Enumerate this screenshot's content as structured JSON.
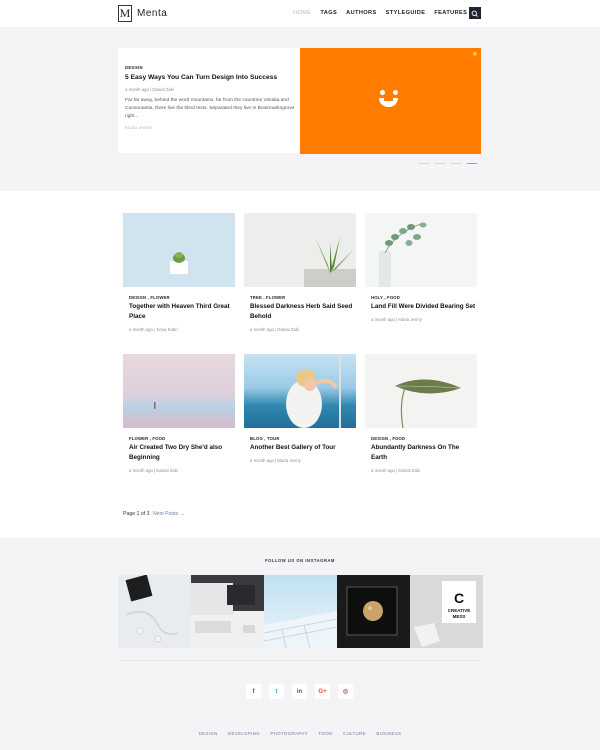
{
  "header": {
    "logo_letter": "M",
    "logo_text": "Menta",
    "nav": [
      "HOME",
      "TAGS",
      "AUTHORS",
      "STYLEGUIDE",
      "FEATURES"
    ]
  },
  "hero": {
    "category": "DESIGN",
    "title": "5 Easy Ways You Can Turn Design Into Success",
    "meta": "a month ago | Danial Zaki",
    "excerpt": "Far far away, behind the word mountains, far from the countries Vokalia and Consonantia, there live the blind texts. Separated they live in Bookmarksgrove right...",
    "read_more": "READ MORE",
    "accent_color": "#ff7c00"
  },
  "posts": [
    {
      "categories": "DESIGN , FLOWER",
      "title": "Together with Heaven Third Great Place",
      "meta": "a month ago | Sona Kabri"
    },
    {
      "categories": "TREE , FLOWER",
      "title": "Blessed Darkness Herb Said Seed Behold",
      "meta": "a month ago | Danial Zaki"
    },
    {
      "categories": "HOLY , FOOD",
      "title": "Land Fill Were Divided Bearing Set",
      "meta": "a month ago | Maria Jenny"
    },
    {
      "categories": "FLOWER , FOOD",
      "title": "Air Created Two Dry She'd also Beginning",
      "meta": "a month ago | Danial Zaki"
    },
    {
      "categories": "BLOG , TOUR",
      "title": "Another Best Gallery of Tour",
      "meta": "a month ago | Maria Jenny"
    },
    {
      "categories": "DESIGN , FOOD",
      "title": "Abundantly Darkness On The Earth",
      "meta": "a month ago | Danial Zaki"
    }
  ],
  "pagination": {
    "text": "Page 1 of 3",
    "next": "Next Posts →"
  },
  "instagram": {
    "heading": "FOLLOW US ON INSTAGRAM",
    "sign_text": "CREATIVE MESS"
  },
  "socials": [
    {
      "icon": "facebook-icon",
      "glyph": "f",
      "color": "#3b5998"
    },
    {
      "icon": "twitter-icon",
      "glyph": "t",
      "color": "#1da1f2"
    },
    {
      "icon": "linkedin-icon",
      "glyph": "in",
      "color": "#0077b5"
    },
    {
      "icon": "google-plus-icon",
      "glyph": "G+",
      "color": "#dd4b39"
    },
    {
      "icon": "instagram-icon",
      "glyph": "◎",
      "color": "#e1306c"
    }
  ],
  "footer_links": [
    "DESIGN",
    "DEVELOPING",
    "PHOTOGRAPHY",
    "FOOD",
    "CULTURE",
    "BUSINESS"
  ]
}
